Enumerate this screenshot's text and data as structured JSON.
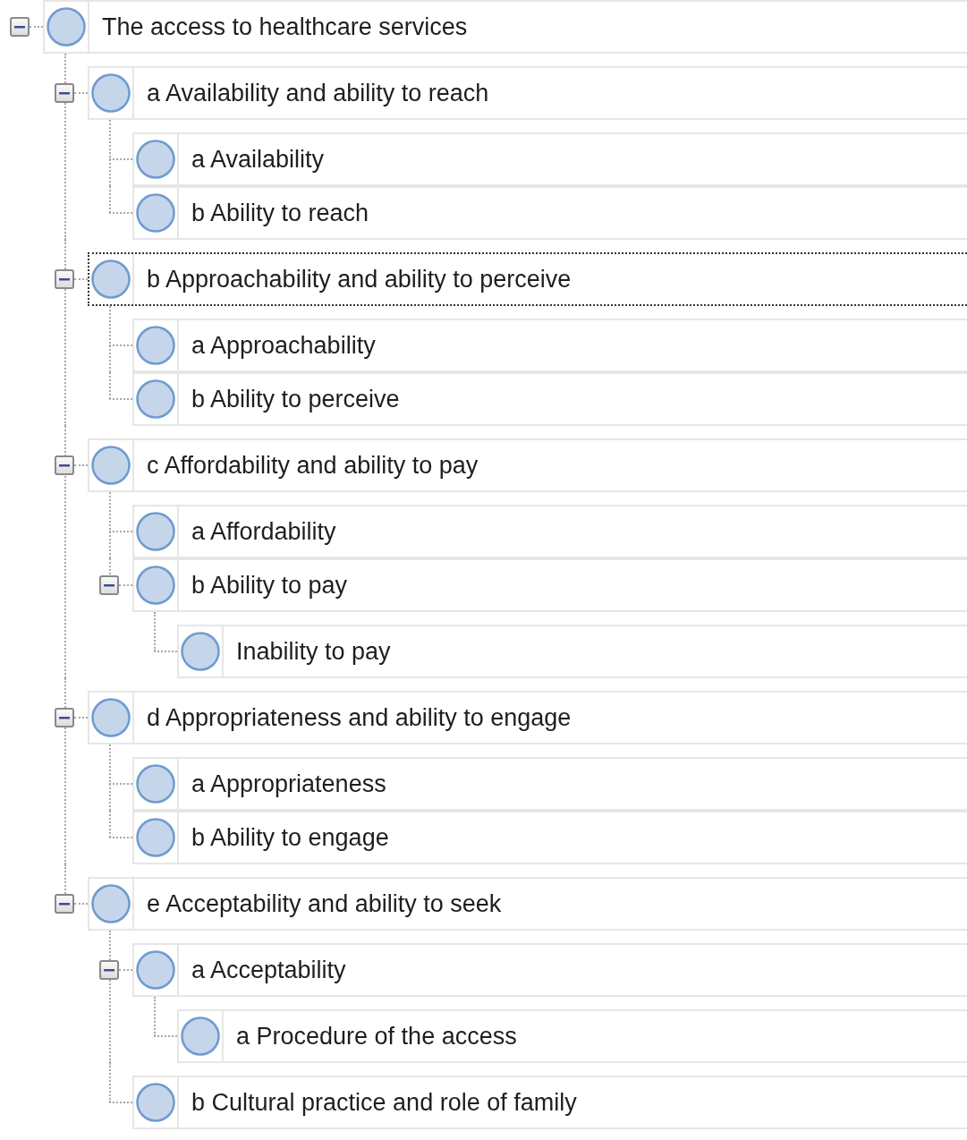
{
  "tree": [
    {
      "label": "The access to healthcare services",
      "selected": false,
      "expanded": true,
      "children": [
        {
          "label": "a Availability and ability to reach",
          "selected": false,
          "expanded": true,
          "children": [
            {
              "label": "a Availability",
              "selected": false
            },
            {
              "label": "b Ability to reach",
              "selected": false
            }
          ]
        },
        {
          "label": "b Approachability and ability to perceive",
          "selected": true,
          "expanded": true,
          "children": [
            {
              "label": "a Approachability",
              "selected": false
            },
            {
              "label": "b Ability to perceive",
              "selected": false
            }
          ]
        },
        {
          "label": "c Affordability and ability to pay",
          "selected": false,
          "expanded": true,
          "children": [
            {
              "label": "a Affordability",
              "selected": false
            },
            {
              "label": "b Ability to pay",
              "selected": false,
              "expanded": true,
              "children": [
                {
                  "label": "Inability to pay",
                  "selected": false
                }
              ]
            }
          ]
        },
        {
          "label": "d Appropriateness and ability to engage",
          "selected": false,
          "expanded": true,
          "children": [
            {
              "label": "a Appropriateness",
              "selected": false
            },
            {
              "label": "b Ability to engage",
              "selected": false
            }
          ]
        },
        {
          "label": "e Acceptability and ability to seek",
          "selected": false,
          "expanded": true,
          "children": [
            {
              "label": "a Acceptability",
              "selected": false,
              "expanded": true,
              "children": [
                {
                  "label": "a Procedure of the access",
                  "selected": false
                }
              ]
            },
            {
              "label": "b Cultural practice and role of family",
              "selected": false
            }
          ]
        }
      ]
    }
  ]
}
